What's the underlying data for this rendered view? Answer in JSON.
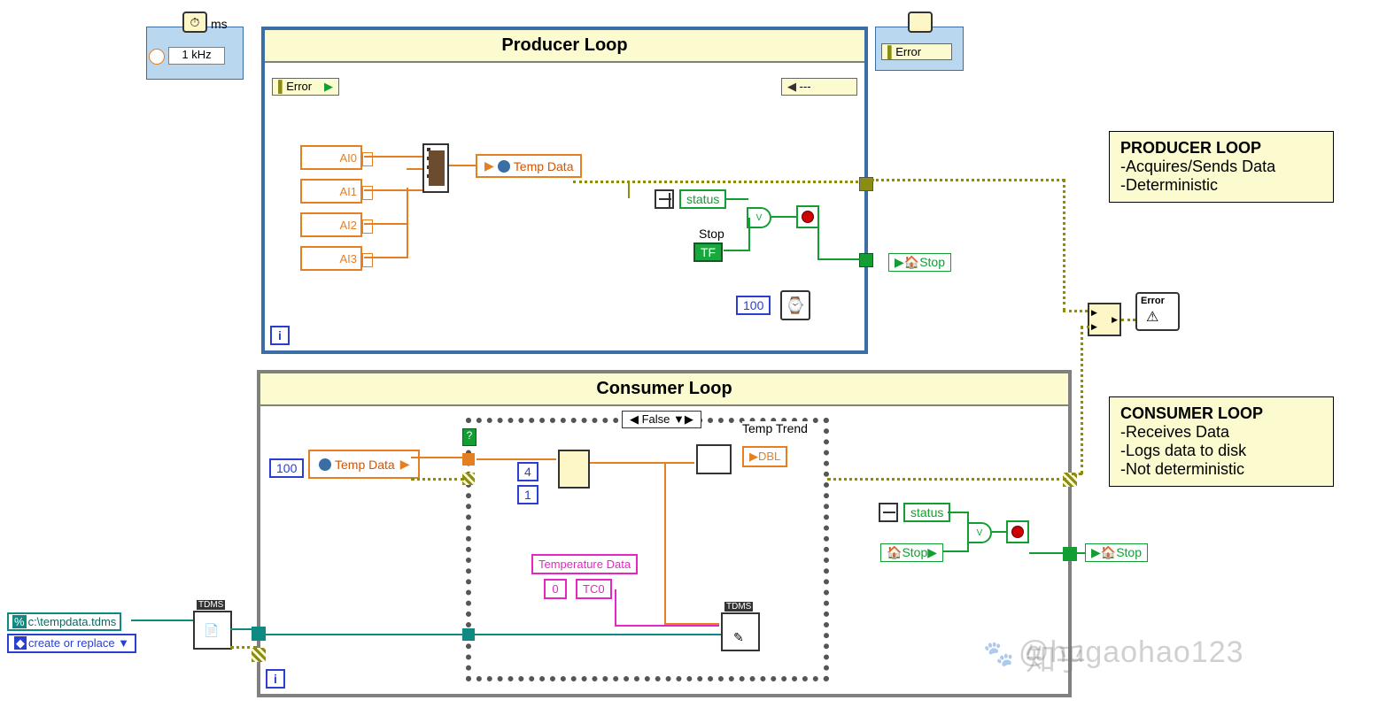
{
  "timedLoop": {
    "periodLabel": "ms",
    "periodValue": "1 kHz",
    "leftTerminal": "Error",
    "rightTerminal": "Error",
    "rightConfig": "---"
  },
  "producerLoop": {
    "title": "Producer Loop",
    "channels": [
      "AI0",
      "AI1",
      "AI2",
      "AI3"
    ],
    "sharedVar": "Temp Data",
    "statusLabel": "status",
    "stopLabel": "Stop",
    "stopBoolean": "TF",
    "waitConst": "100",
    "stopIndicator": "Stop",
    "iteration": "i"
  },
  "consumerLoop": {
    "title": "Consumer Loop",
    "queueSizeConst": "100",
    "sharedVar": "Temp Data",
    "caseSelector": "False",
    "indexConst1": "4",
    "indexConst2": "1",
    "tempTrendLabel": "Temp Trend",
    "tempTrendType": "DBL",
    "tempDataLabel": "Temperature Data",
    "tempDataIndex": "0",
    "tempDataChannel": "TC0",
    "statusLabel": "status",
    "stopLocal": "Stop",
    "stopIndicator": "Stop",
    "tdmsPath": "c:\\tempdata.tdms",
    "tdmsMode": "create or replace",
    "tdmsLabel": "TDMS",
    "iteration": "i"
  },
  "notes": {
    "producer": {
      "title": "PRODUCER LOOP",
      "line1": "-Acquires/Sends Data",
      "line2": "-Deterministic"
    },
    "consumer": {
      "title": "CONSUMER LOOP",
      "line1": "-Receives Data",
      "line2": "-Logs data to disk",
      "line3": "-Not deterministic"
    }
  },
  "errorDialogLabel": "Error",
  "watermark1": "知乎",
  "watermark2": "@hugaohao123"
}
